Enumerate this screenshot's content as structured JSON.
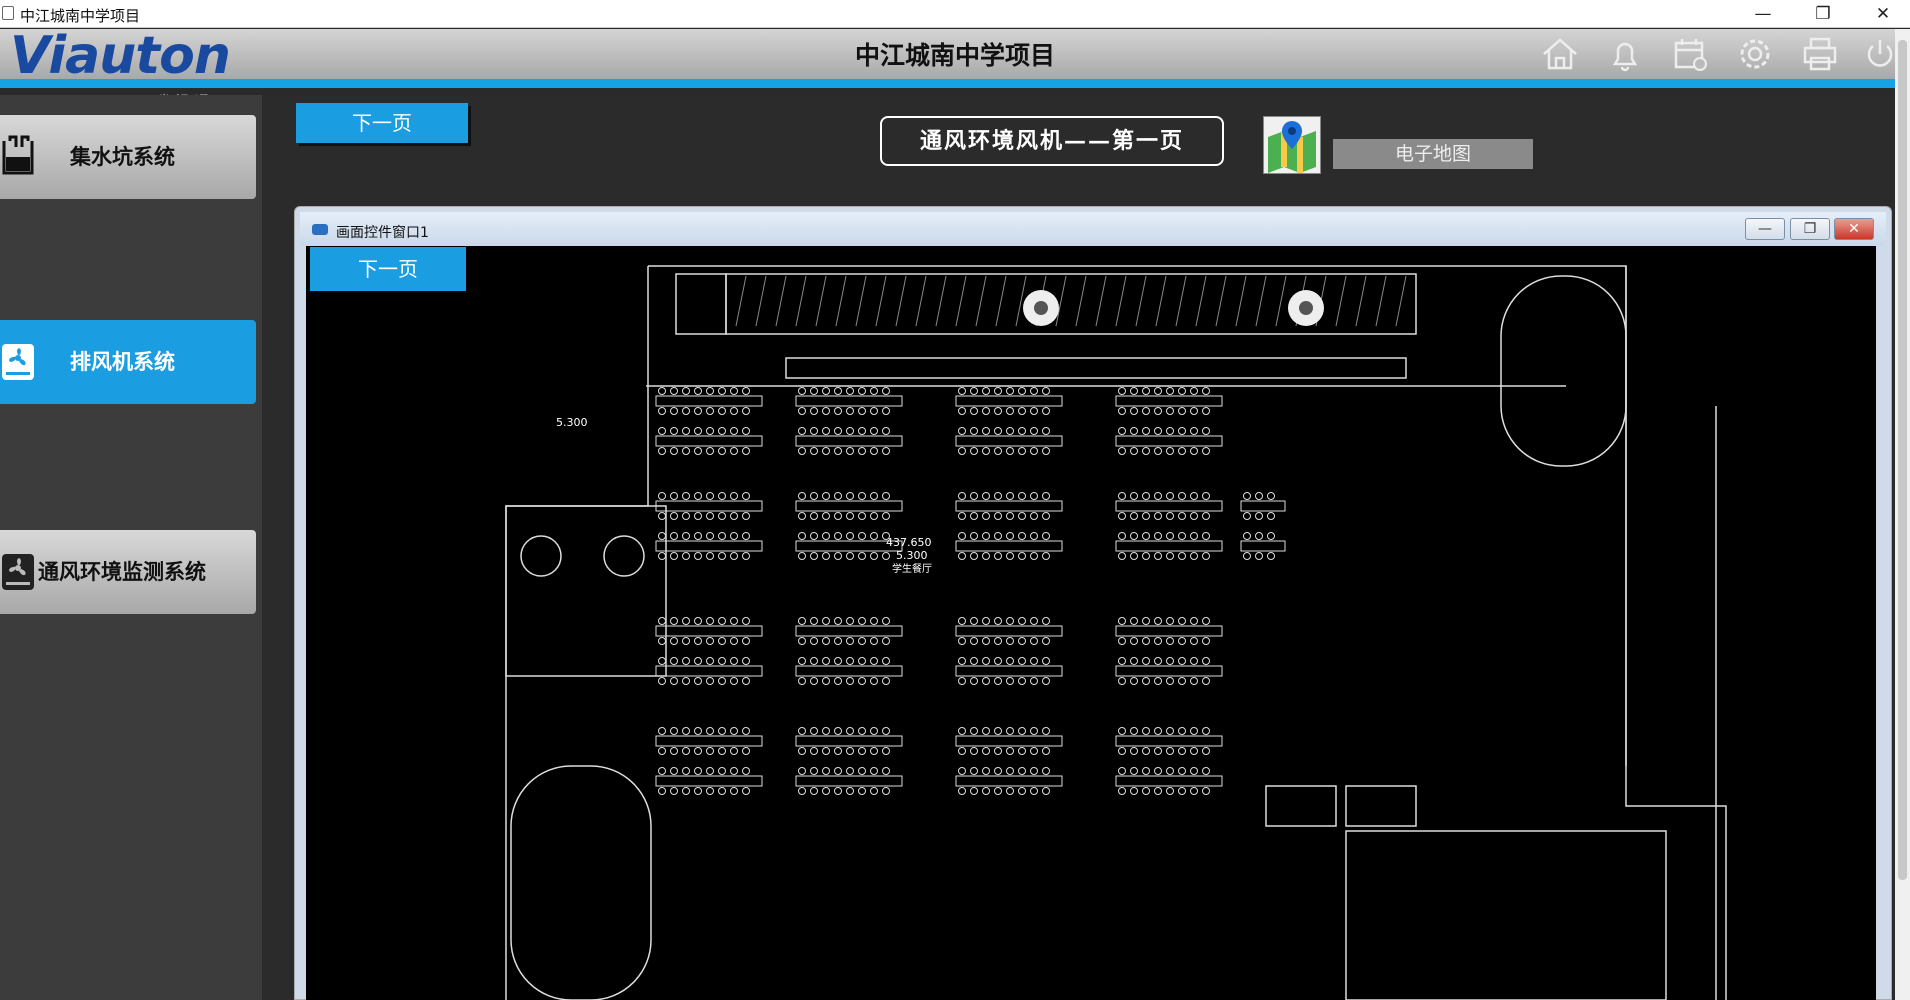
{
  "os_window": {
    "title": "中江城南中学项目",
    "controls": [
      "—",
      "❐",
      "✕"
    ]
  },
  "header": {
    "logo_text": "Viauton",
    "logo_sub": "—瑞视通—",
    "title": "中江城南中学项目",
    "icons": [
      "home-icon",
      "bell-icon",
      "calendar-icon",
      "gear-icon",
      "printer-icon",
      "power-icon"
    ],
    "accent": "#16a3e5"
  },
  "sidebar": {
    "items": [
      {
        "label": "集水坑系统",
        "active": false,
        "icon": "tank-icon"
      },
      {
        "label": "排风机系统",
        "active": true,
        "icon": "fan-icon"
      },
      {
        "label": "通风环境监测系统",
        "active": false,
        "icon": "fan-icon"
      }
    ]
  },
  "main": {
    "next_page": "下一页",
    "page_heading": "通风环境风机——第一页",
    "map_button": "电子地图"
  },
  "inner_window": {
    "title": "画面控件窗口1",
    "next_page": "下一页",
    "controls": [
      "—",
      "❐",
      "✕"
    ],
    "plan_labels": {
      "elevation": "437.650",
      "level": "5.300",
      "room": "学生餐厅",
      "level_top": "5.300"
    }
  }
}
